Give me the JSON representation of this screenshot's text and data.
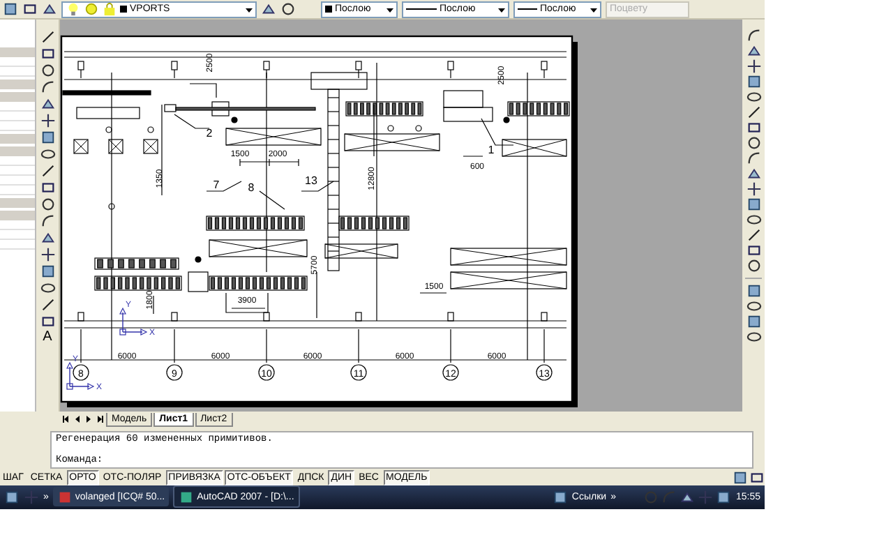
{
  "toolbar": {
    "layer": "VPORTS",
    "color_setting": "Послою",
    "linetype": "Послою",
    "lineweight": "Послою",
    "plot_style": {
      "value": "Поцвету",
      "disabled": true
    }
  },
  "drawing": {
    "labels": [
      {
        "text": "2500",
        "kind": "dimension"
      },
      {
        "text": "2",
        "kind": "callout"
      },
      {
        "text": "1500",
        "kind": "dimension"
      },
      {
        "text": "2000",
        "kind": "dimension"
      },
      {
        "text": "13",
        "kind": "callout"
      },
      {
        "text": "7",
        "kind": "callout"
      },
      {
        "text": "8",
        "kind": "callout"
      },
      {
        "text": "1350",
        "kind": "dimension"
      },
      {
        "text": "12800",
        "kind": "dimension"
      },
      {
        "text": "1",
        "kind": "callout"
      },
      {
        "text": "600",
        "kind": "dimension"
      },
      {
        "text": "2500",
        "kind": "dimension"
      },
      {
        "text": "5700",
        "kind": "dimension"
      },
      {
        "text": "1500",
        "kind": "dimension"
      },
      {
        "text": "3900",
        "kind": "dimension"
      },
      {
        "text": "1800",
        "kind": "dimension"
      },
      {
        "text": "6000",
        "kind": "dimension"
      },
      {
        "text": "6000",
        "kind": "dimension"
      },
      {
        "text": "6000",
        "kind": "dimension"
      },
      {
        "text": "6000",
        "kind": "dimension"
      },
      {
        "text": "6000",
        "kind": "dimension"
      }
    ],
    "axes": [
      "8",
      "9",
      "10",
      "11",
      "12",
      "13"
    ],
    "ucs": [
      {
        "y": "Y",
        "x": "X"
      },
      {
        "y": "Y",
        "x": "X"
      }
    ]
  },
  "draw_toolbar": {
    "text_tool": "A"
  },
  "layout_tabs": [
    {
      "label": "Модель",
      "selected": false
    },
    {
      "label": "Лист1",
      "selected": true
    },
    {
      "label": "Лист2",
      "selected": false
    }
  ],
  "command": {
    "history": "Регенерация 60 измененных примитивов.",
    "prompt": "Команда:"
  },
  "status_toggles": [
    {
      "label": "ШАГ",
      "on": false
    },
    {
      "label": "СЕТКА",
      "on": false
    },
    {
      "label": "ОРТО",
      "on": true
    },
    {
      "label": "ОТС-ПОЛЯР",
      "on": false
    },
    {
      "label": "ПРИВЯЗКА",
      "on": true
    },
    {
      "label": "ОТС-ОБЪЕКТ",
      "on": true
    },
    {
      "label": "ДПСК",
      "on": false
    },
    {
      "label": "ДИН",
      "on": true
    },
    {
      "label": "ВЕС",
      "on": false
    },
    {
      "label": "МОДЕЛЬ",
      "on": true
    }
  ],
  "taskbar": {
    "quick_launch_more": "»",
    "tasks": [
      {
        "label": "volanged   [ICQ# 50...",
        "selected": false
      },
      {
        "label": "AutoCAD 2007 - [D:\\...",
        "selected": true
      }
    ],
    "links": "Ссылки",
    "links_more": "»",
    "clock": "15:55"
  }
}
